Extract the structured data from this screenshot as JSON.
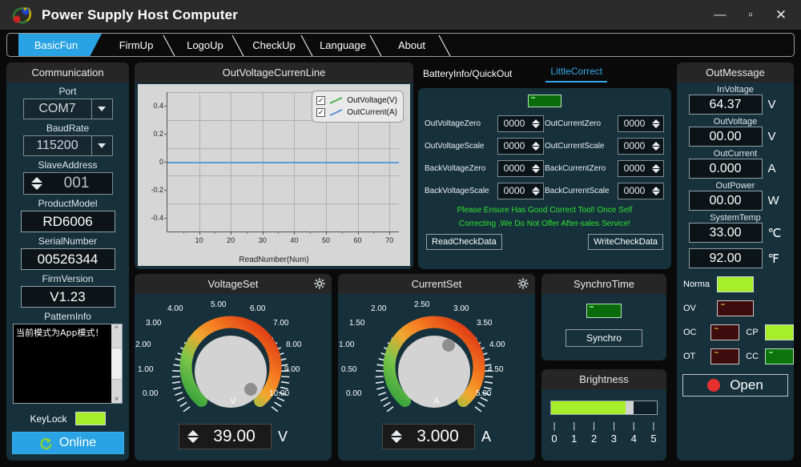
{
  "window": {
    "title": "Power Supply Host Computer",
    "logo_icon": "app-logo-icon",
    "minimize": "—",
    "maximize": "▫",
    "close": "✕"
  },
  "tabs": [
    {
      "label": "BasicFun",
      "active": true
    },
    {
      "label": "FirmUp",
      "active": false
    },
    {
      "label": "LogoUp",
      "active": false
    },
    {
      "label": "CheckUp",
      "active": false
    },
    {
      "label": "Language",
      "active": false
    },
    {
      "label": "About",
      "active": false
    }
  ],
  "communication": {
    "title": "Communication",
    "port_label": "Port",
    "port_value": "COM7",
    "baud_label": "BaudRate",
    "baud_value": "115200",
    "slave_label": "SlaveAddress",
    "slave_value": "001",
    "product_label": "ProductModel",
    "product_value": "RD6006",
    "serial_label": "SerialNumber",
    "serial_value": "00526344",
    "firm_label": "FirmVersion",
    "firm_value": "V1.23",
    "pattern_label": "PatternInfo",
    "pattern_text": "当前模式为App模式！",
    "keylock_label": "KeyLock",
    "keylock_state": "on",
    "online_label": "Online",
    "online_icon": "refresh-icon",
    "accent": "#29a3e3"
  },
  "chart_data": {
    "type": "line",
    "title": "OutVoltageCurrenLine",
    "xlabel": "ReadNumber(Num)",
    "ylabel": "",
    "xlim": [
      0,
      73
    ],
    "ylim": [
      -0.5,
      0.5
    ],
    "xticks": [
      10,
      20,
      30,
      40,
      50,
      60,
      70
    ],
    "yticks": [
      -0.4,
      -0.2,
      0,
      0.2,
      0.4
    ],
    "ytick_labels": [
      "-0.4",
      "-0.2",
      "0",
      "0.2",
      "0.4"
    ],
    "grid": true,
    "legend_position": "top-right",
    "series": [
      {
        "name": "OutVoltage(V)",
        "color": "#4caf50",
        "checked": true,
        "values": [
          0,
          0,
          0,
          0,
          0,
          0,
          0,
          0
        ]
      },
      {
        "name": "OutCurrent(A)",
        "color": "#5b8fd5",
        "checked": true,
        "values": [
          0,
          0,
          0,
          0,
          0,
          0,
          0,
          0
        ]
      }
    ],
    "x": [
      0,
      10,
      20,
      30,
      40,
      50,
      60,
      73
    ]
  },
  "subtabs": [
    {
      "label": "BatteryInfo/QuickOut",
      "active": false
    },
    {
      "label": "LittleCorrect",
      "active": true
    }
  ],
  "little_correct": {
    "led_state": "on",
    "fields": [
      {
        "label": "OutVoltageZero",
        "value": "0000"
      },
      {
        "label": "OutCurrentZero",
        "value": "0000"
      },
      {
        "label": "OutVoltageScale",
        "value": "0000"
      },
      {
        "label": "OutCurrentScale",
        "value": "0000"
      },
      {
        "label": "BackVoltageZero",
        "value": "0000"
      },
      {
        "label": "BackCurrentZero",
        "value": "0000"
      },
      {
        "label": "BackVoltageScale",
        "value": "0000"
      },
      {
        "label": "BackCurrentScale",
        "value": "0000"
      }
    ],
    "warning_line1": "Please Ensure Has Good Correct Tool!  Once Self",
    "warning_line2": "Correcting ,We Do Not Offer After-sales Service!",
    "warning_color": "#2fe32f",
    "read_button": "ReadCheckData",
    "write_button": "WriteCheckData"
  },
  "out_message": {
    "title": "OutMessage",
    "readouts": [
      {
        "label": "InVoltage",
        "value": "64.37",
        "unit": "V"
      },
      {
        "label": "OutVoltage",
        "value": "00.00",
        "unit": "V"
      },
      {
        "label": "OutCurrent",
        "value": "0.000",
        "unit": "A"
      },
      {
        "label": "OutPower",
        "value": "00.00",
        "unit": "W"
      },
      {
        "label": "SystemTemp",
        "value": "33.00",
        "unit": "℃"
      },
      {
        "label": "",
        "value": "92.00",
        "unit": "℉"
      }
    ],
    "status": [
      {
        "label": "Norma",
        "state": "lime"
      },
      {
        "label": "OV",
        "state": "dark-red"
      },
      {
        "label": "OC",
        "state": "dark-red"
      },
      {
        "label": "CP",
        "state": "lime"
      },
      {
        "label": "OT",
        "state": "dark-red"
      },
      {
        "label": "CC",
        "state": "green"
      }
    ],
    "open_button": "Open",
    "open_indicator": "red-dot-icon"
  },
  "voltage_set": {
    "title": "VoltageSet",
    "gear_icon": "gear-icon",
    "unit_glyph": "V",
    "scale_labels": [
      "0.00",
      "1.00",
      "2.00",
      "3.00",
      "4.00",
      "5.00",
      "6.00",
      "7.00",
      "8.00",
      "9.00",
      "10.00"
    ],
    "value": "39.00",
    "unit": "V",
    "knob_angle_deg": 125
  },
  "current_set": {
    "title": "CurrentSet",
    "gear_icon": "gear-icon",
    "unit_glyph": "A",
    "scale_labels": [
      "0.00",
      "0.50",
      "1.00",
      "1.50",
      "2.00",
      "2.50",
      "3.00",
      "3.50",
      "4.00",
      "4.50",
      "5.00"
    ],
    "value": "3.000",
    "unit": "A",
    "knob_angle_deg": 20
  },
  "synchro_time": {
    "title": "SynchroTime",
    "led_state": "on",
    "button": "Synchro"
  },
  "brightness": {
    "title": "Brightness",
    "value": 4,
    "max": 5,
    "labels": [
      "0",
      "1",
      "2",
      "3",
      "4",
      "5"
    ],
    "fill_color": "#a6ee2a"
  }
}
